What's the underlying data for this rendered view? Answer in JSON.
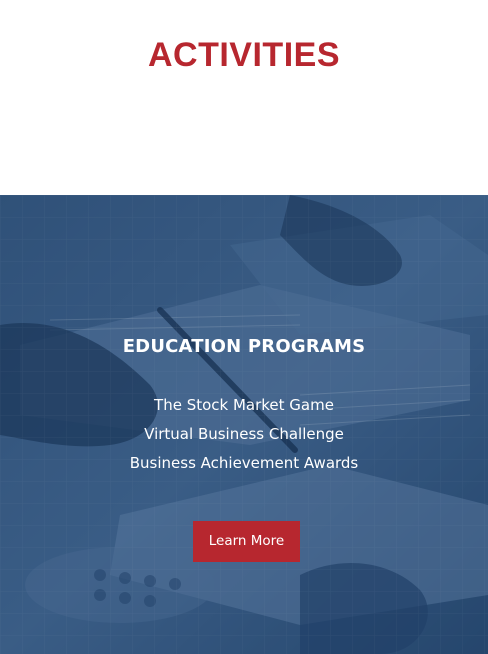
{
  "section": {
    "title": "ACTIVITIES"
  },
  "hero": {
    "heading": "EDUCATION PROGRAMS",
    "programs": [
      "The Stock Market Game",
      "Virtual Business Challenge",
      "Business Achievement Awards"
    ],
    "button_label": "Learn More",
    "background_image": "business-documents-photo"
  },
  "colors": {
    "brand_red": "#b7272f",
    "overlay_blue": "#2f4f74",
    "text_white": "#ffffff"
  }
}
